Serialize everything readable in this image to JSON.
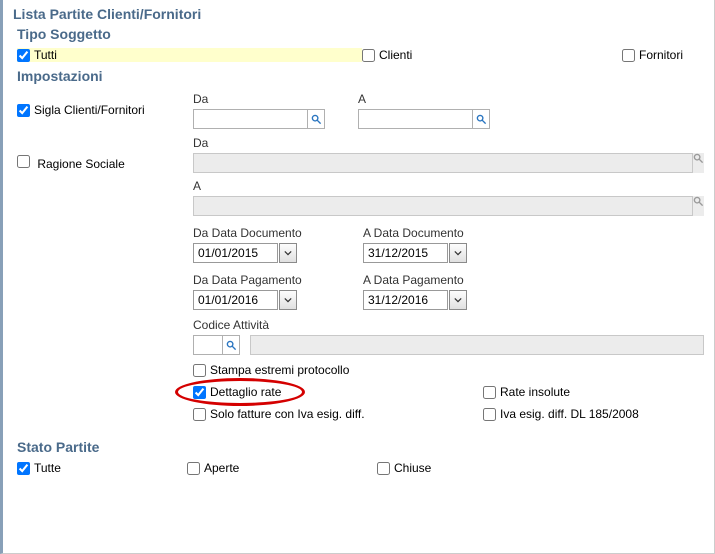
{
  "title": "Lista Partite Clienti/Fornitori",
  "sections": {
    "tipo_soggetto": {
      "heading": "Tipo Soggetto",
      "tutti": "Tutti",
      "clienti": "Clienti",
      "fornitori": "Fornitori"
    },
    "impostazioni": {
      "heading": "Impostazioni",
      "sigla_label": "Sigla Clienti/Fornitori",
      "ragione_label": "Ragione Sociale",
      "da": "Da",
      "a": "A",
      "da_data_documento": "Da Data Documento",
      "a_data_documento": "A Data Documento",
      "da_data_documento_val": "01/01/2015",
      "a_data_documento_val": "31/12/2015",
      "da_data_pagamento": "Da Data Pagamento",
      "a_data_pagamento": "A Data Pagamento",
      "da_data_pagamento_val": "01/01/2016",
      "a_data_pagamento_val": "31/12/2016",
      "codice_attivita": "Codice Attività",
      "stampa_estremi": "Stampa estremi protocollo",
      "dettaglio_rate": "Dettaglio rate",
      "rate_insolute": "Rate insolute",
      "solo_fatture": "Solo fatture con Iva esig. diff.",
      "iva_esig": "Iva esig. diff. DL 185/2008"
    },
    "stato_partite": {
      "heading": "Stato Partite",
      "tutte": "Tutte",
      "aperte": "Aperte",
      "chiuse": "Chiuse"
    }
  }
}
